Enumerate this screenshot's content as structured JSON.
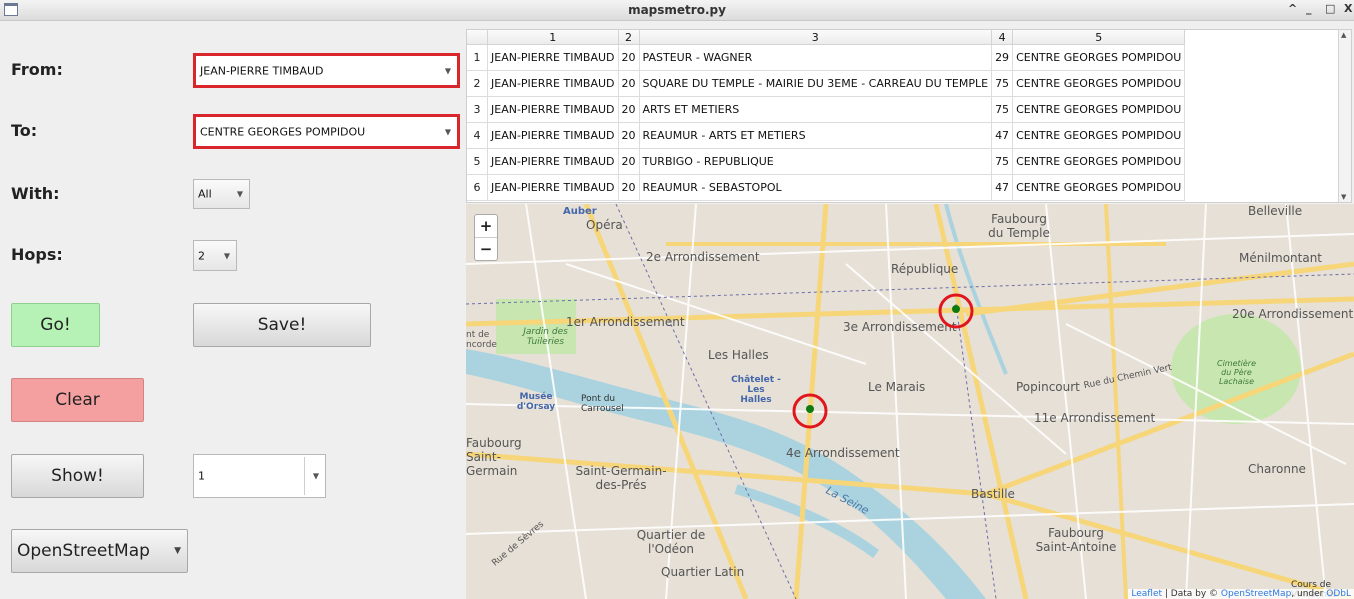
{
  "window": {
    "title": "mapsmetro.py",
    "controls": [
      "^",
      "_",
      "□",
      "X"
    ]
  },
  "form": {
    "from_label": "From:",
    "from_value": "JEAN-PIERRE TIMBAUD",
    "to_label": "To:",
    "to_value": "CENTRE GEORGES POMPIDOU",
    "with_label": "With:",
    "with_value": "All",
    "hops_label": "Hops:",
    "hops_value": "2",
    "go_label": "Go!",
    "save_label": "Save!",
    "clear_label": "Clear",
    "show_label": "Show!",
    "show_value": "1",
    "map_provider": "OpenStreetMap"
  },
  "table": {
    "headers": [
      "1",
      "2",
      "3",
      "4",
      "5"
    ],
    "rows": [
      {
        "n": "1",
        "c1": "JEAN-PIERRE TIMBAUD",
        "c2": "20",
        "c3": "PASTEUR - WAGNER",
        "c4": "29",
        "c5": "CENTRE GEORGES POMPIDOU"
      },
      {
        "n": "2",
        "c1": "JEAN-PIERRE TIMBAUD",
        "c2": "20",
        "c3": "SQUARE DU TEMPLE - MAIRIE DU 3EME - CARREAU DU TEMPLE",
        "c4": "75",
        "c5": "CENTRE GEORGES POMPIDOU"
      },
      {
        "n": "3",
        "c1": "JEAN-PIERRE TIMBAUD",
        "c2": "20",
        "c3": "ARTS ET METIERS",
        "c4": "75",
        "c5": "CENTRE GEORGES POMPIDOU"
      },
      {
        "n": "4",
        "c1": "JEAN-PIERRE TIMBAUD",
        "c2": "20",
        "c3": "REAUMUR - ARTS ET METIERS",
        "c4": "47",
        "c5": "CENTRE GEORGES POMPIDOU"
      },
      {
        "n": "5",
        "c1": "JEAN-PIERRE TIMBAUD",
        "c2": "20",
        "c3": "TURBIGO - REPUBLIQUE",
        "c4": "75",
        "c5": "CENTRE GEORGES POMPIDOU"
      },
      {
        "n": "6",
        "c1": "JEAN-PIERRE TIMBAUD",
        "c2": "20",
        "c3": "REAUMUR - SEBASTOPOL",
        "c4": "47",
        "c5": "CENTRE GEORGES POMPIDOU"
      }
    ]
  },
  "map": {
    "zoom_in": "+",
    "zoom_out": "−",
    "labels": {
      "auber": "Auber",
      "opera": "Opéra",
      "arr2": "2e Arrondissement",
      "faubourg_temple": "Faubourg du Temple",
      "belleville": "Belleville",
      "menilmontant": "Ménilmontant",
      "republique": "République",
      "arr1": "1er Arrondissement",
      "arr3": "3e Arrondissement",
      "arr20": "20e Arrondissement",
      "jardin_tuileries": "Jardin des Tuileries",
      "concorde": "nt de ncorde",
      "les_halles": "Les Halles",
      "chatelet": "Châtelet - Les Halles",
      "le_marais": "Le Marais",
      "popincourt": "Popincourt",
      "chemin_vert": "Rue du Chemin Vert",
      "cimetiere": "Cimetière du Père Lachaise",
      "musee_orsay": "Musée d'Orsay",
      "pont_carrousel": "Pont du Carrousel",
      "arr11": "11e Arrondissement",
      "faubourg_st_germain": "Faubourg Saint-Germain",
      "saint_germain": "Saint-Germain-des-Prés",
      "arr4": "4e Arrondissement",
      "charonne": "Charonne",
      "bastille": "Bastille",
      "la_seine": "La Seine",
      "quartier_odeon": "Quartier de l'Odéon",
      "faubourg_st_antoine": "Faubourg Saint-Antoine",
      "quartier_latin": "Quartier Latin",
      "rue_sevres": "Rue de Sèvres",
      "cours_vincennes": "Cours de Vincennes"
    },
    "attribution_prefix": "Leaflet",
    "attribution_mid": " | Data by © ",
    "attribution_osm": "OpenStreetMap",
    "attribution_suffix": ", under ",
    "attribution_odbl": "ODbL",
    "colors": {
      "marker": "#0e7a0e",
      "highlight": "#e0161c",
      "water": "#aad3df",
      "park": "#c8e6b0",
      "road_major": "#f7d67a",
      "road_minor": "#ffffff",
      "metro": "#6d6ea8"
    }
  }
}
